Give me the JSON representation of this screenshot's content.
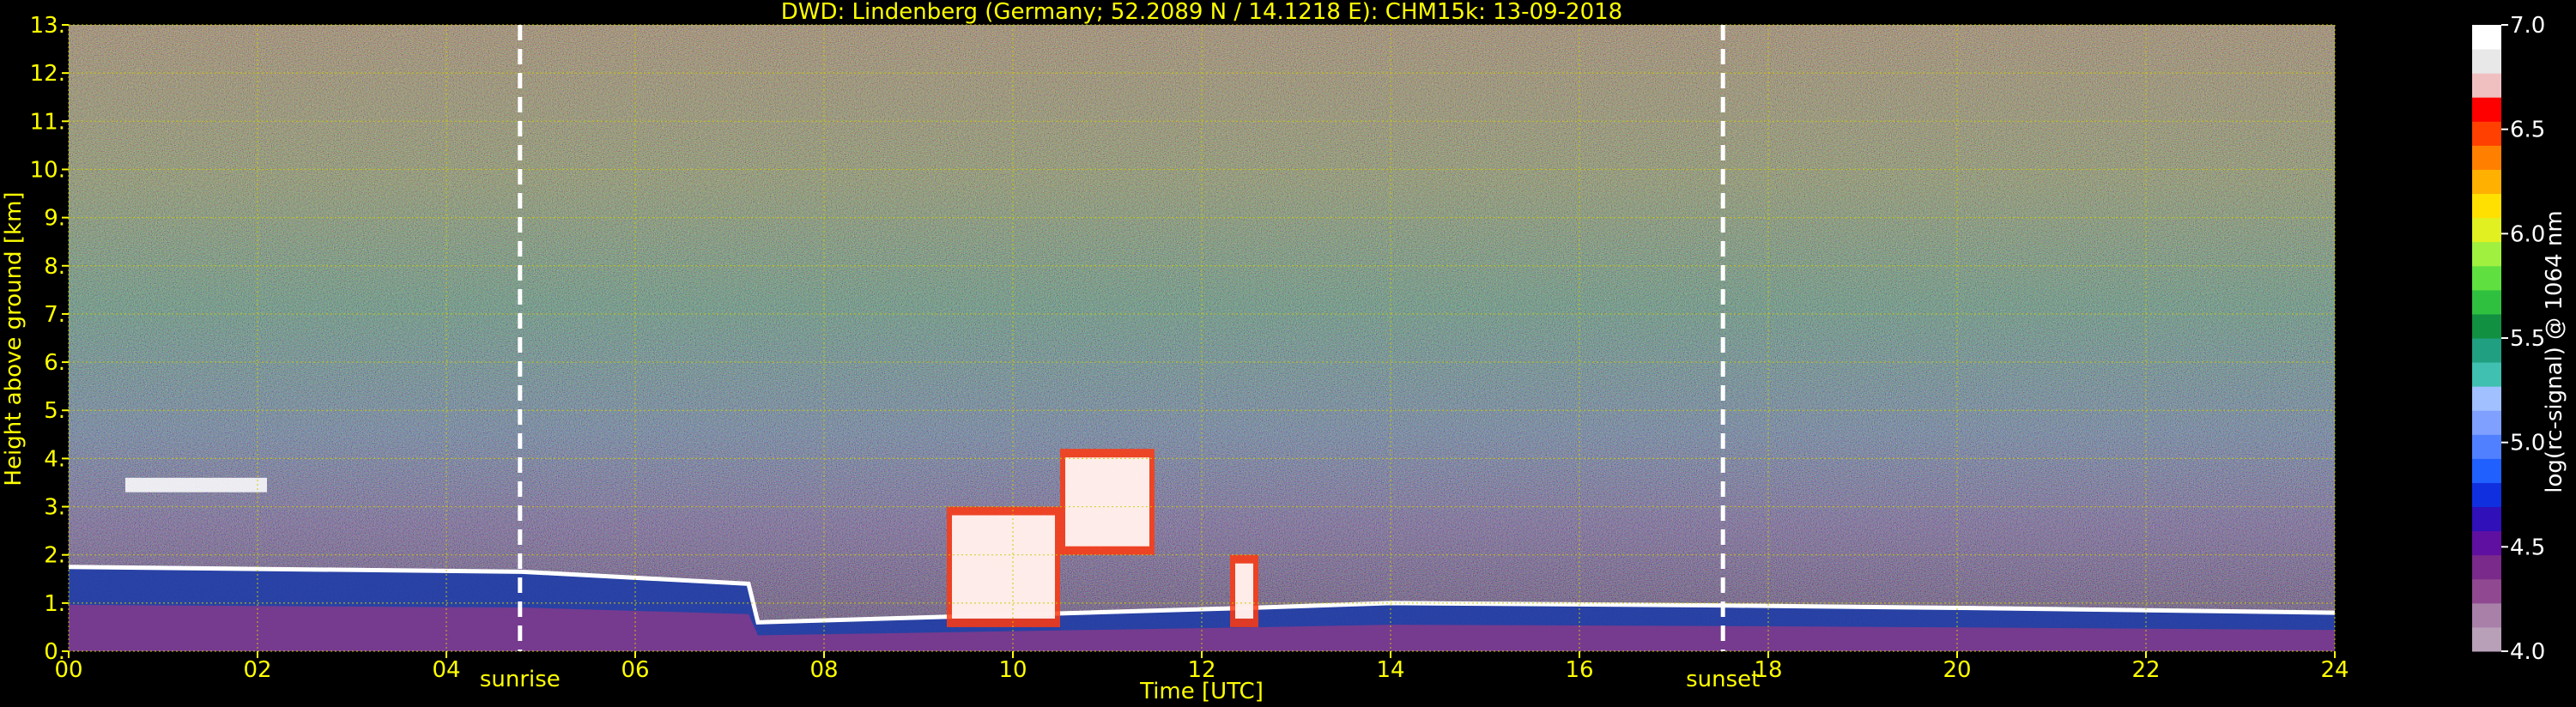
{
  "chart_data": {
    "type": "heatmap",
    "title": "DWD: Lindenberg (Germany; 52.2089 N / 14.1218 E):    CHM15k: 13-09-2018",
    "xlabel": "Time [UTC]",
    "ylabel": "Height above ground [km]",
    "xlim": [
      0,
      24
    ],
    "ylim": [
      0,
      13
    ],
    "x_ticks": [
      0,
      2,
      4,
      6,
      8,
      10,
      12,
      14,
      16,
      18,
      20,
      22,
      24
    ],
    "x_tick_labels": [
      "00",
      "02",
      "04",
      "06",
      "08",
      "10",
      "12",
      "14",
      "16",
      "18",
      "20",
      "22",
      "24"
    ],
    "y_ticks": [
      0,
      1,
      2,
      3,
      4,
      5,
      6,
      7,
      8,
      9,
      10,
      11,
      12,
      13
    ],
    "y_tick_labels": [
      "0.",
      "1.",
      "2.",
      "3.",
      "4.",
      "5.",
      "6.",
      "7.",
      "8.",
      "9.",
      "10.",
      "11.",
      "12.",
      "13."
    ],
    "grid": true,
    "events": [
      {
        "label": "sunrise",
        "time": 4.78
      },
      {
        "label": "sunset",
        "time": 17.52
      }
    ],
    "colorbar": {
      "label": "log(rc-signal) @ 1064 nm",
      "range": [
        4.0,
        7.0
      ],
      "tick_values": [
        4.0,
        4.5,
        5.0,
        5.5,
        6.0,
        6.5,
        7.0
      ],
      "tick_labels": [
        "4.0",
        "4.5",
        "5.0",
        "5.5",
        "6.0",
        "6.5",
        "7.0"
      ]
    },
    "features": [
      {
        "description": "boundary layer aerosol (heights in km)",
        "segments": [
          [
            0,
            1.75
          ],
          [
            4.8,
            1.65
          ],
          [
            7.2,
            1.4
          ],
          [
            7.3,
            0.6
          ],
          [
            12.5,
            0.9
          ],
          [
            14.0,
            1.0
          ],
          [
            17.5,
            0.95
          ],
          [
            20.0,
            0.9
          ],
          [
            24,
            0.8
          ]
        ]
      },
      {
        "description": "convective clouds (km)",
        "ranges": [
          [
            9.3,
            10.5,
            0.5,
            3.0
          ],
          [
            10.5,
            11.5,
            2.0,
            4.2
          ],
          [
            12.3,
            12.6,
            0.5,
            2.0
          ]
        ]
      },
      {
        "description": "elevated layer (km)",
        "ranges": [
          [
            0.6,
            2.1,
            3.3,
            3.6
          ]
        ]
      }
    ]
  },
  "colors": {
    "background": "#000000",
    "text": "#ffff00",
    "grid": "#cccc00",
    "event_line": "#ffffff",
    "colorbar_text": "#ffffff"
  }
}
